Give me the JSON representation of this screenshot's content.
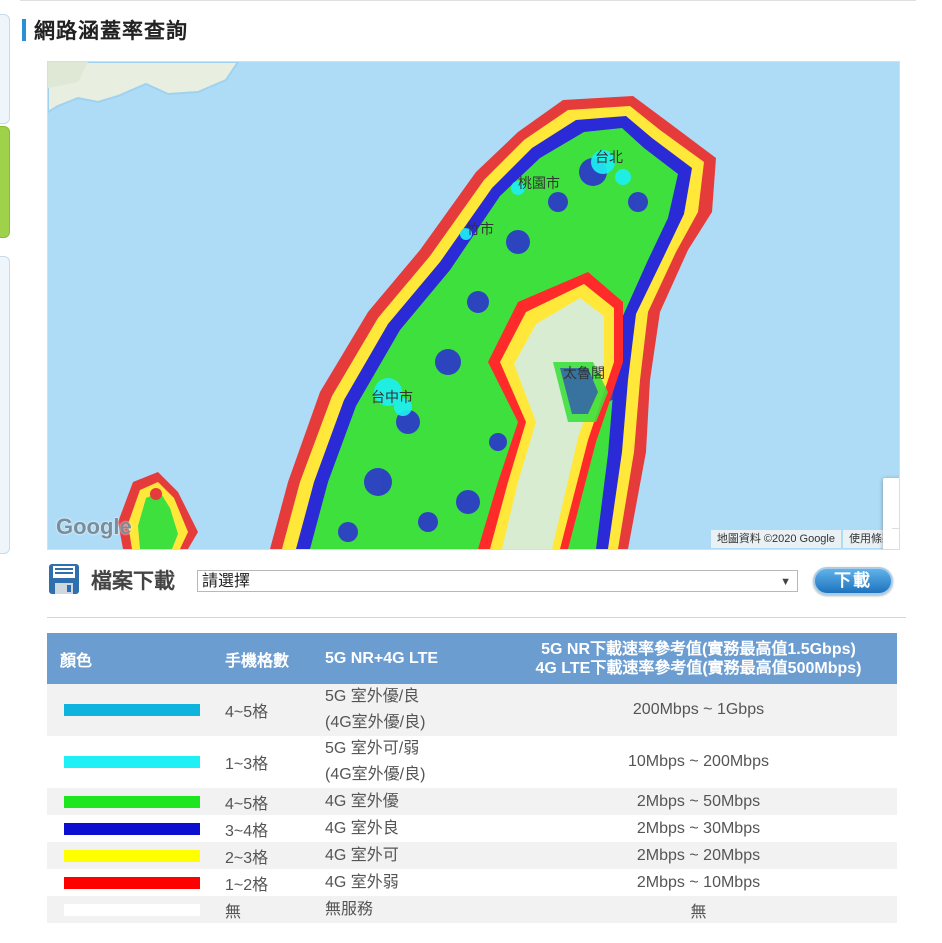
{
  "section_title": "網路涵蓋率查詢",
  "map": {
    "zoom_in": "+",
    "zoom_out": "−",
    "google_logo": "Google",
    "attribution": "地圖資料 ©2020 Google",
    "terms": "使用條款",
    "city_labels": [
      "台北",
      "桃園市",
      "竹市",
      "台中市",
      "太魯閣"
    ]
  },
  "download": {
    "label": "檔案下載",
    "select_value": "請選擇",
    "button_label": "下載"
  },
  "legend": {
    "headers": {
      "color": "顏色",
      "bars": "手機格數",
      "tech": "5G NR+4G LTE",
      "speed_line1": "5G NR下載速率參考值(實務最高值1.5Gbps)",
      "speed_line2": "4G LTE下載速率參考值(實務最高值500Mbps)"
    },
    "rows": [
      {
        "color": "#0fb4de",
        "bars": "4~5格",
        "desc1": "5G 室外優/良",
        "desc2": "(4G室外優/良)",
        "speed": "200Mbps ~ 1Gbps"
      },
      {
        "color": "#1ef0f5",
        "bars": "1~3格",
        "desc1": "5G 室外可/弱",
        "desc2": "(4G室外優/良)",
        "speed": "10Mbps ~ 200Mbps"
      },
      {
        "color": "#1ee61e",
        "bars": "4~5格",
        "desc1": "4G 室外優",
        "speed": "2Mbps ~ 50Mbps"
      },
      {
        "color": "#0c0ed0",
        "bars": "3~4格",
        "desc1": "4G 室外良",
        "speed": "2Mbps ~ 30Mbps"
      },
      {
        "color": "#ffff00",
        "bars": "2~3格",
        "desc1": "4G 室外可",
        "speed": "2Mbps ~ 20Mbps"
      },
      {
        "color": "#ff0000",
        "bars": "1~2格",
        "desc1": "4G 室外弱",
        "speed": "2Mbps ~ 10Mbps"
      },
      {
        "color": "#ffffff",
        "bars": "無",
        "desc1": "無服務",
        "speed": "無"
      }
    ]
  }
}
